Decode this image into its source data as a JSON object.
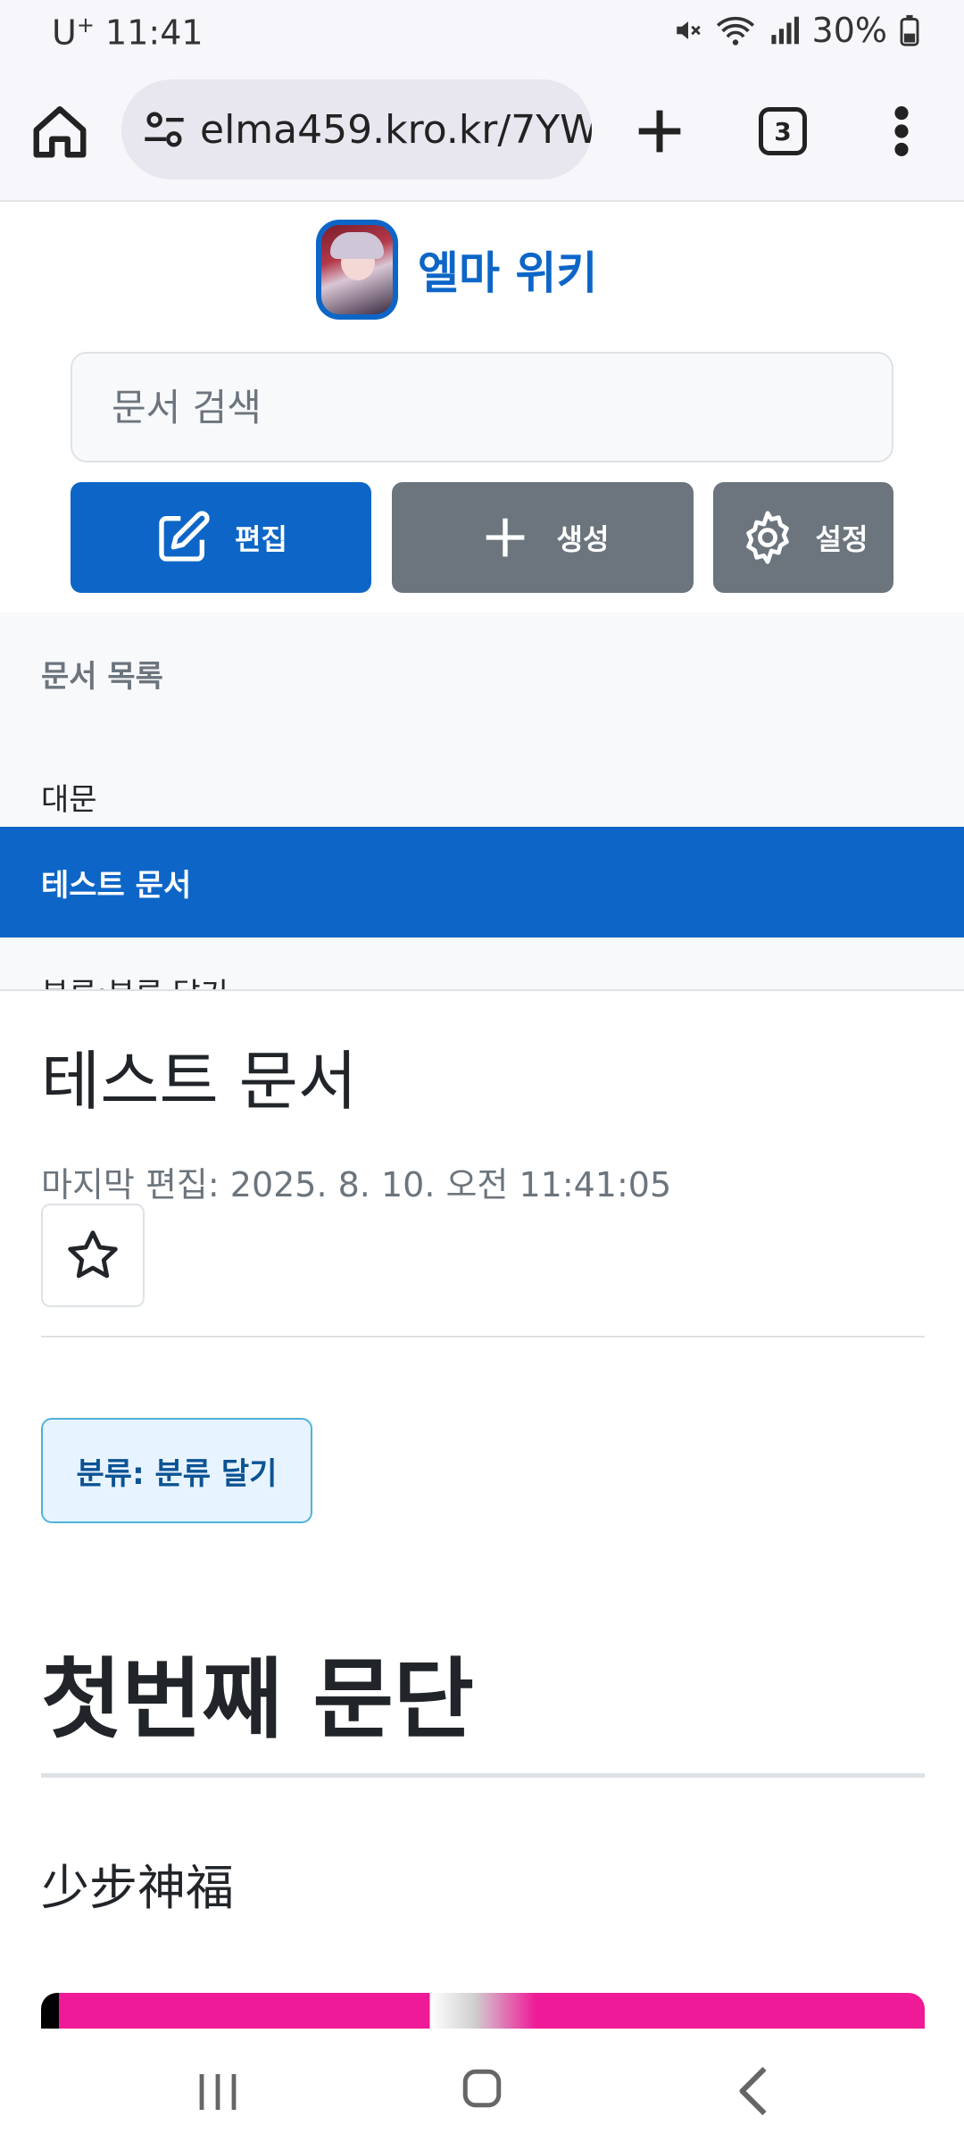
{
  "status_bar": {
    "carrier": "U",
    "carrier_sup": "+",
    "time": "11:41",
    "battery": "30%"
  },
  "browser": {
    "url": "elma459.kro.kr/7YW",
    "tab_count": "3"
  },
  "wiki": {
    "title": "엘마 위키",
    "search_placeholder": "문서 검색",
    "buttons": {
      "edit": "편집",
      "create": "생성",
      "settings": "설정"
    }
  },
  "doc_list": {
    "heading": "문서 목록",
    "items": [
      {
        "label": "대문"
      },
      {
        "label": "테스트 문서",
        "active": true
      },
      {
        "label": "분류:분류 달기"
      }
    ]
  },
  "document": {
    "title": "테스트 문서",
    "last_edit": "마지막 편집: 2025. 8. 10. 오전 11:41:05",
    "category": "분류: 분류 달기",
    "heading": "첫번째 문단",
    "paragraph": "少步神福"
  },
  "colors": {
    "primary": "#0d66c7",
    "secondary": "#6c757d",
    "category_bg": "#e7f3ff",
    "image_pink": "#ef1a97"
  }
}
